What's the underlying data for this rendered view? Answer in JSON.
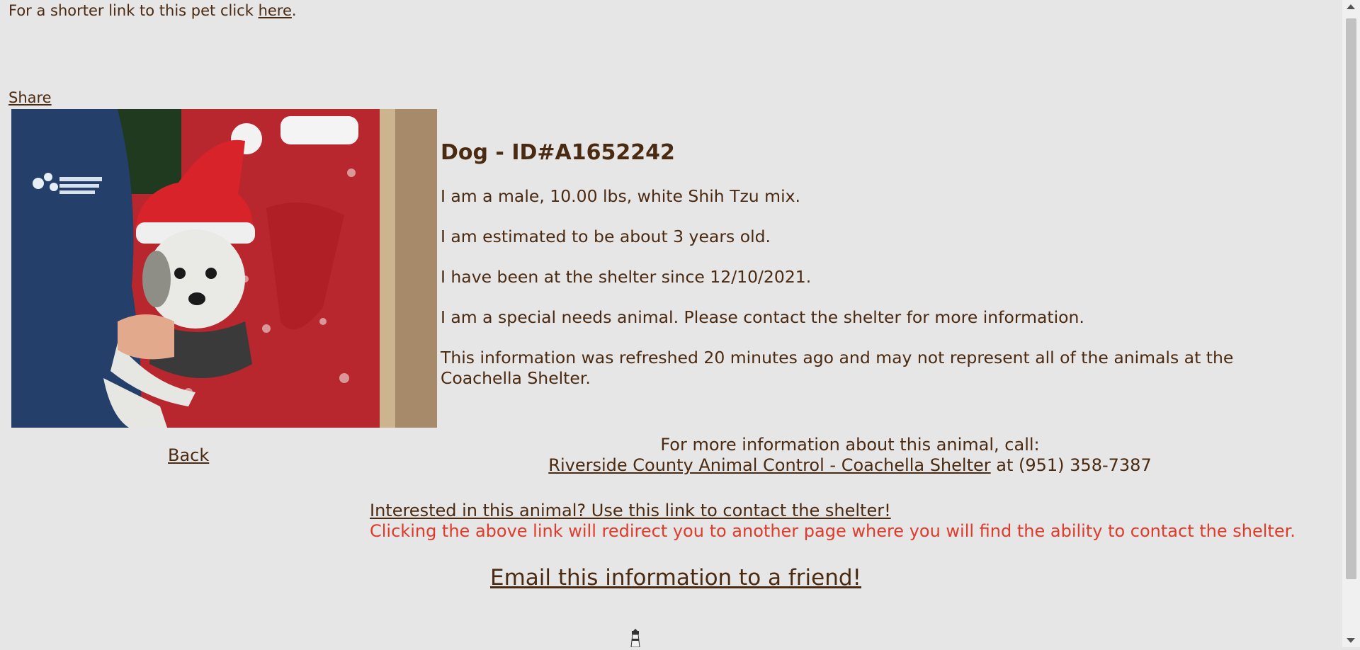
{
  "short_link": {
    "prefix": "For a shorter link to this pet click ",
    "link": "here",
    "suffix": "."
  },
  "share_label": "Share",
  "pet": {
    "title": "Dog - ID#A1652242",
    "description": "I am a male, 10.00 lbs, white Shih Tzu mix.",
    "age": "I am estimated to be about 3 years old.",
    "since": "I have been at the shelter since 12/10/2021.",
    "special_needs": "I am a special needs animal. Please contact the shelter for more information.",
    "refreshed": "This information was refreshed 20 minutes ago and may not represent all of the animals at the Coachella Shelter."
  },
  "back_label": "Back",
  "contact": {
    "intro": "For more information about this animal, call:",
    "shelter_link": "Riverside County Animal Control - Coachella Shelter",
    "phone_text": " at (951) 358-7387"
  },
  "interest": {
    "link": "Interested in this animal? Use this link to contact the shelter!",
    "note": "Clicking the above link will redirect you to another page where you will find the ability to contact the shelter."
  },
  "email_label": "Email this information to a friend!",
  "icons": [
    "lighthouse-icon",
    "scroll-up-icon",
    "scroll-down-icon"
  ],
  "colors": {
    "background": "#e6e6e6",
    "text": "#4a2a10",
    "warning": "#e03a2a"
  }
}
